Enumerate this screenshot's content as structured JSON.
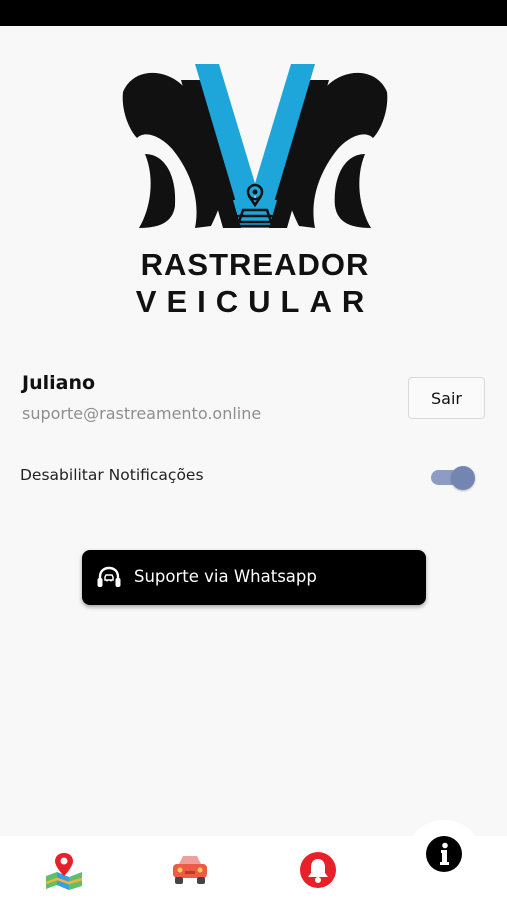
{
  "logo": {
    "line1": "RASTREADOR",
    "line2": "VEICULAR"
  },
  "profile": {
    "name": "Juliano",
    "email": "suporte@rastreamento.online",
    "logout_label": "Sair"
  },
  "settings": {
    "disable_notifications_label": "Desabilitar Notificações",
    "disable_notifications_on": true
  },
  "support": {
    "label": "Suporte via Whatsapp"
  },
  "bottom_nav": {
    "items": [
      {
        "icon": "map-pin-icon"
      },
      {
        "icon": "car-icon"
      },
      {
        "icon": "bell-icon"
      },
      {
        "icon": "info-icon"
      }
    ]
  },
  "colors": {
    "brand_blue": "#1ea6db",
    "toggle_on": "#7386b2",
    "alert_red": "#e8202a",
    "car_red": "#ee5a45"
  }
}
